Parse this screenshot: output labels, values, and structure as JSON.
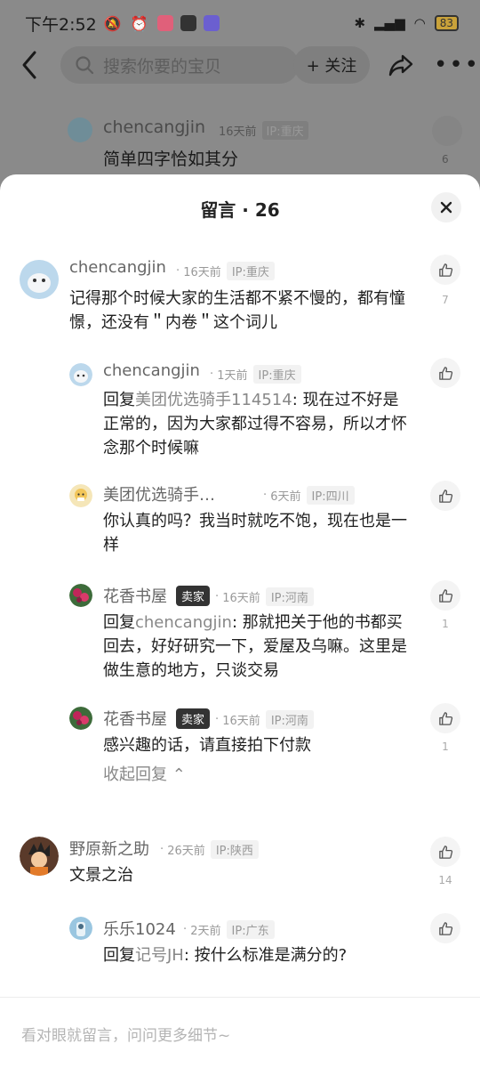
{
  "status_bar": {
    "time": "下午2:52",
    "battery": "83"
  },
  "header": {
    "search_placeholder": "搜索你要的宝贝",
    "follow_label": "+ 关注"
  },
  "background_comment": {
    "name": "chencangjin",
    "time": "16天前",
    "ip": "IP:重庆",
    "text": "简单四字恰如其分",
    "likes": "6"
  },
  "sheet": {
    "title": "留言 · 26"
  },
  "comments": [
    {
      "name": "chencangjin",
      "time": "16天前",
      "ip": "IP:重庆",
      "text": "记得那个时候大家的生活都不紧不慢的，都有憧憬，还没有＂内卷＂这个词儿",
      "likes": "7"
    },
    {
      "name": "chencangjin",
      "time": "1天前",
      "ip": "IP:重庆",
      "reply_prefix": "回复",
      "mention": "美团优选骑手114514",
      "text": ":    现在过不好是正常的，因为大家都过得不容易，所以才怀念那个时候嘛",
      "likes": ""
    },
    {
      "name": "美团优选骑手…",
      "time": "6天前",
      "ip": "IP:四川",
      "text": "你认真的吗？我当时就吃不饱，现在也是一样",
      "likes": ""
    },
    {
      "name": "花香书屋",
      "badge": "卖家",
      "time": "16天前",
      "ip": "IP:河南",
      "reply_prefix": "回复",
      "mention": "chencangjin",
      "text": ": 那就把关于他的书都买回去，好好研究一下，爱屋及乌嘛。这里是做生意的地方，只谈交易",
      "likes": "1"
    },
    {
      "name": "花香书屋",
      "badge": "卖家",
      "time": "16天前",
      "ip": "IP:河南",
      "text": "感兴趣的话，请直接拍下付款",
      "likes": "1"
    },
    {
      "name": "野原新之助",
      "time": "26天前",
      "ip": "IP:陕西",
      "text": "文景之治",
      "likes": "14"
    },
    {
      "name": "乐乐1024",
      "time": "2天前",
      "ip": "IP:广东",
      "reply_prefix": "回复",
      "mention": "记号JH",
      "text": ": 按什么标准是满分的?",
      "likes": ""
    }
  ],
  "collapse_label": "收起回复",
  "input_placeholder": "看对眼就留言，问问更多细节~"
}
